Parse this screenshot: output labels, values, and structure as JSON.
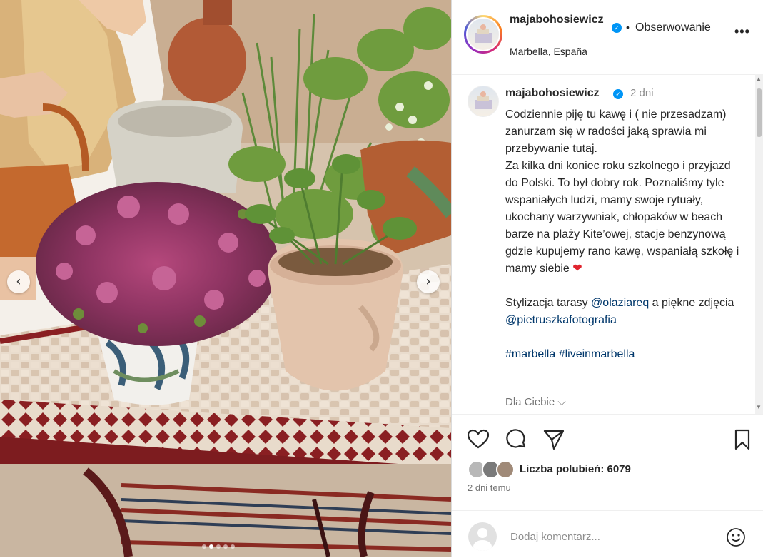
{
  "post": {
    "username_header": "majabohosiewicz",
    "follow_label": "Obserwowanie",
    "bullet": "•",
    "more_label": "•••",
    "location": "Marbella, España",
    "verified_mark": "✓"
  },
  "caption": {
    "username": "majabohosiewicz",
    "time": "2 dni",
    "text_main": "Codziennie piję tu kawę i ( nie przesadzam) zanurzam się w radości jaką sprawia mi przebywanie tutaj.\nZa kilka dni koniec roku szkolnego i przyjazd do Polski. To był dobry rok. Poznaliśmy tyle wspaniałych ludzi, mamy swoje rytuały, ukochany warzywniak, chłopaków w beach barze na plaży Kite’owej, stacje benzynową gdzie kupujemy rano kawę, wspaniałą szkołę i mamy siebie",
    "heart_emoji": "❤",
    "styl_prefix": "Stylizacja tarasy",
    "styl_mention1": "@olaziareq",
    "styl_mid": "a piękne zdjęcia",
    "styl_mention2": "@pietruszkafotografia",
    "hashtags": "#marbella #liveinmarbella",
    "dla_ciebie": "Dla Ciebie ⌵"
  },
  "actions": {
    "likes": "Liczba polubień: 6079",
    "posted_ago": "2 dni temu"
  },
  "comment": {
    "placeholder": "Dodaj komentarz..."
  },
  "carousel": {
    "prev": "‹",
    "next": "›",
    "total_slides": 5,
    "current_slide": 2
  },
  "colors": {
    "verified": "#0095f6",
    "link": "#00376b",
    "heart": "#e0242e",
    "muted": "#8e8e8e"
  }
}
